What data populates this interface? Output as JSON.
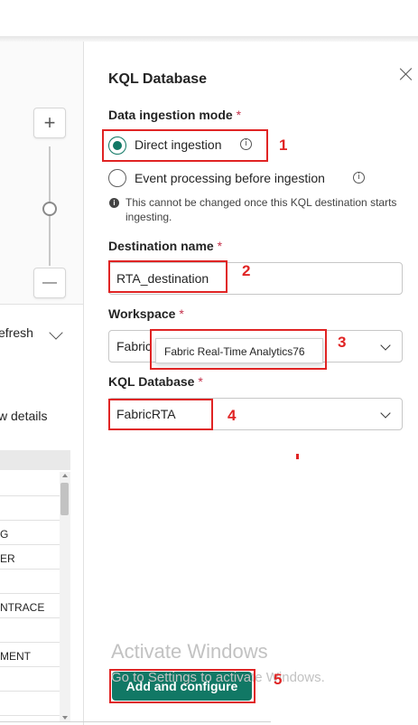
{
  "left_pane": {
    "refresh_text": "efresh",
    "details_text": "w details",
    "rows": [
      "",
      "",
      "G",
      "ER",
      "",
      "NTRACE",
      "",
      "MENT",
      "",
      ""
    ],
    "zoom_in_symbol": "+",
    "zoom_out_symbol": "—"
  },
  "panel": {
    "title": "KQL Database",
    "close_icon": "close-icon",
    "ingestion_mode": {
      "label": "Data ingestion mode",
      "required_mark": "*",
      "options": [
        {
          "label": "Direct ingestion",
          "selected": true
        },
        {
          "label": "Event processing before ingestion",
          "selected": false
        }
      ],
      "info_glyph": "i",
      "note": "This cannot be changed once this KQL destination starts ingesting."
    },
    "destination": {
      "label": "Destination name",
      "required_mark": "*",
      "value": "RTA_destination"
    },
    "workspace": {
      "label": "Workspace",
      "required_mark": "*",
      "value": "Fabric",
      "tooltip": "Fabric Real-Time Analytics76"
    },
    "kql_database": {
      "label": "KQL Database",
      "required_mark": "*",
      "value": "FabricRTA"
    },
    "primary_button": "Add and configure"
  },
  "annotations": [
    "1",
    "2",
    "3",
    "4",
    "5"
  ],
  "watermark": {
    "line1": "Activate Windows",
    "line2": "Go to Settings to activate Windows."
  },
  "colors": {
    "accent": "#117865",
    "annotation": "#e02424",
    "required": "#c4314b"
  }
}
